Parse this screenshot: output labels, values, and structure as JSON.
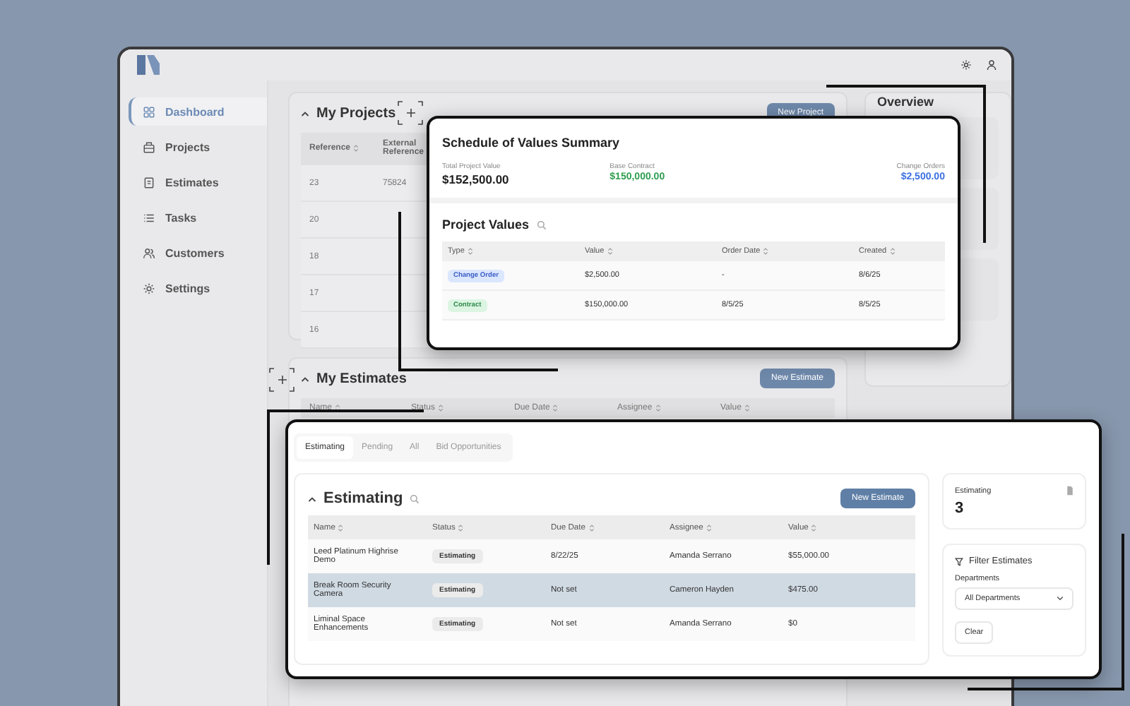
{
  "app": {
    "sidebar": {
      "items": [
        {
          "label": "Dashboard",
          "selected": true
        },
        {
          "label": "Projects",
          "selected": false
        },
        {
          "label": "Estimates",
          "selected": false
        },
        {
          "label": "Tasks",
          "selected": false
        },
        {
          "label": "Customers",
          "selected": false
        },
        {
          "label": "Settings",
          "selected": false
        }
      ]
    },
    "projects": {
      "title": "My Projects",
      "button": "New Project",
      "columns": [
        "Reference",
        "External Reference"
      ],
      "rows": [
        {
          "reference": "23",
          "external_reference": "75824"
        },
        {
          "reference": "20"
        },
        {
          "reference": "18"
        },
        {
          "reference": "17"
        },
        {
          "reference": "16"
        }
      ]
    },
    "overview": {
      "title": "Overview"
    },
    "estimates": {
      "title": "My Estimates",
      "button": "New Estimate",
      "columns": [
        "Name",
        "Status",
        "Due Date",
        "Assignee",
        "Value"
      ]
    }
  },
  "values_summary": {
    "title": "Schedule of Values Summary",
    "totals": [
      {
        "label": "Total Project Value",
        "value": "$152,500.00",
        "color": "#1f1f1f"
      },
      {
        "label": "Base Contract",
        "value": "$150,000.00",
        "color": "#2e9e4f"
      },
      {
        "label": "Change Orders",
        "value": "$2,500.00",
        "color": "#3b6fe0"
      }
    ],
    "section_title": "Project Values",
    "columns": [
      "Type",
      "Value",
      "Order Date",
      "Created"
    ],
    "rows": [
      {
        "type": "Change Order",
        "kind": "change",
        "value": "$2,500.00",
        "order_date": "-",
        "created": "8/6/25"
      },
      {
        "type": "Contract",
        "kind": "contract",
        "value": "$150,000.00",
        "order_date": "8/5/25",
        "created": "8/5/25"
      }
    ]
  },
  "estimating_panel": {
    "tabs": [
      {
        "label": "Estimating",
        "selected": true
      },
      {
        "label": "Pending",
        "selected": false
      },
      {
        "label": "All",
        "selected": false
      },
      {
        "label": "Bid Opportunities",
        "selected": false
      }
    ],
    "title": "Estimating",
    "button": "New Estimate",
    "columns": [
      "Name",
      "Status",
      "Due Date",
      "Assignee",
      "Value"
    ],
    "rows": [
      {
        "name": "Leed Platinum Highrise Demo",
        "status": "Estimating",
        "due_date": "8/22/25",
        "assignee": "Amanda Serrano",
        "value": "$55,000.00",
        "selected": false
      },
      {
        "name": "Break Room Security Camera",
        "status": "Estimating",
        "due_date": "Not set",
        "assignee": "Cameron Hayden",
        "value": "$475.00",
        "selected": true
      },
      {
        "name": "Liminal Space Enhancements",
        "status": "Estimating",
        "due_date": "Not set",
        "assignee": "Amanda Serrano",
        "value": "$0",
        "selected": false
      }
    ],
    "stat": {
      "label": "Estimating",
      "value": "3"
    },
    "filter": {
      "title": "Filter Estimates",
      "field_label": "Departments",
      "select_value": "All Departments",
      "button": "Clear"
    }
  }
}
